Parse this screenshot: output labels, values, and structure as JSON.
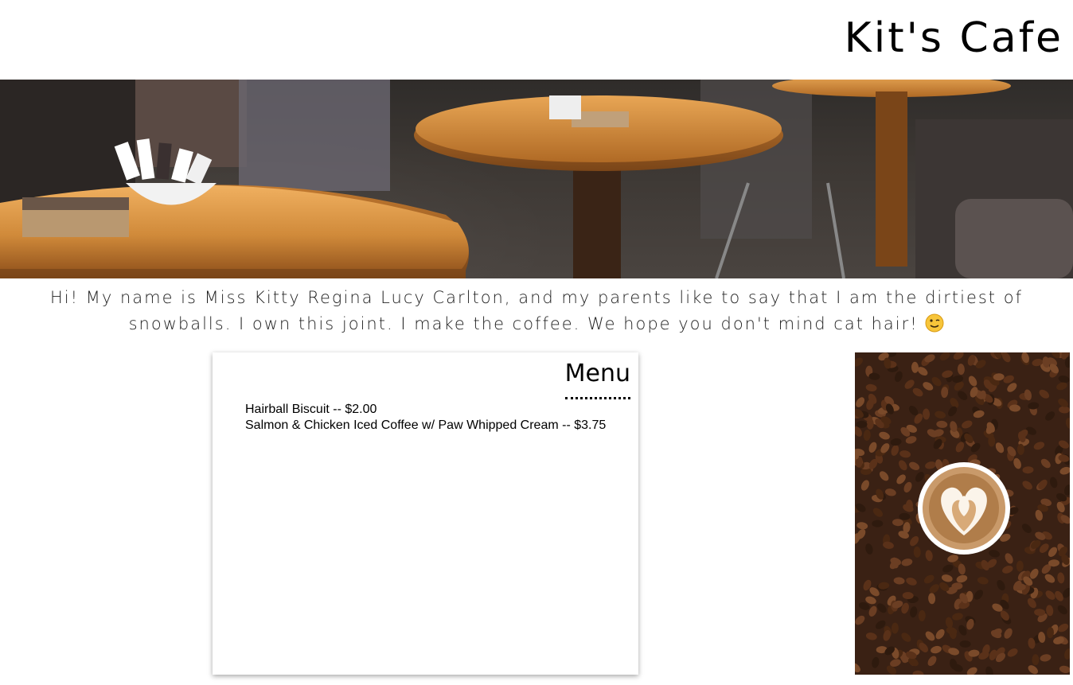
{
  "header": {
    "title": "Kit's Cafe"
  },
  "hero": {
    "image_alt": "Cafe tables with sugar packets"
  },
  "intro": {
    "text": "Hi! My name is Miss Kitty Regina Lucy Carlton, and my parents like to say that I am the dirtiest of snowballs. I own this joint. I make the coffee. We hope you don't mind cat hair!",
    "emoji": "wink-emoji-icon"
  },
  "menu": {
    "heading": "Menu",
    "items": [
      {
        "label": "Hairball Biscuit -- $2.00"
      },
      {
        "label": "Salmon & Chicken Iced Coffee w/ Paw Whipped Cream -- $3.75"
      }
    ]
  },
  "side_photo": {
    "image_alt": "Latte art on coffee beans"
  },
  "colors": {
    "background": "#ffffff",
    "text": "#000000",
    "wood": "#d08a3a",
    "beans": "#3a2114",
    "latte": "#c99a6a"
  }
}
